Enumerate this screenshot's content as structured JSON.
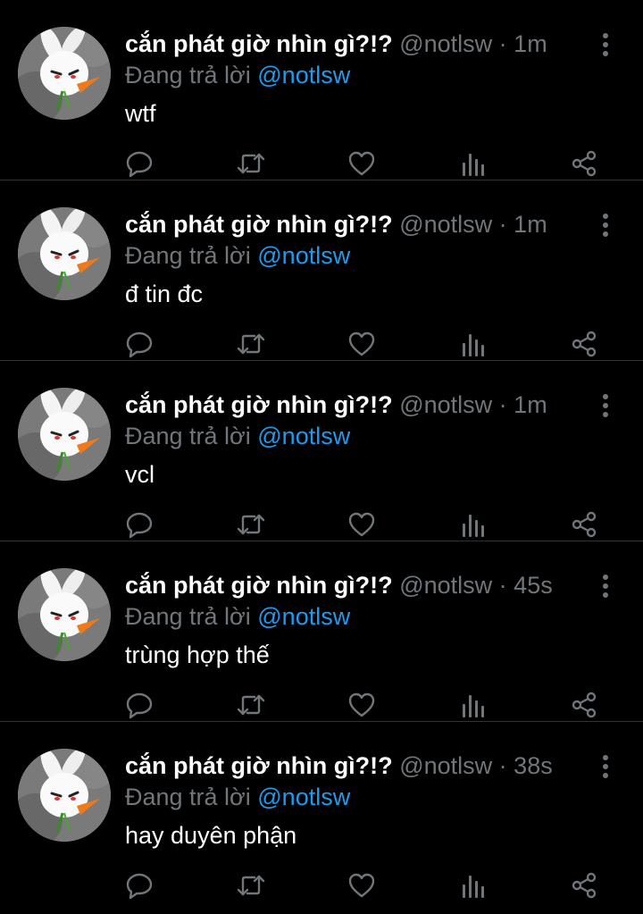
{
  "colors": {
    "background": "#000000",
    "name": "#ffffff",
    "muted": "#71767b",
    "link": "#1d9bf0",
    "divider": "#2f3336"
  },
  "icons": {
    "more": "vertical-ellipsis-icon",
    "reply": "speech-bubble-icon",
    "retweet": "retweet-arrows-icon",
    "like": "heart-icon",
    "stats": "bar-chart-icon",
    "share": "share-icon"
  },
  "tweets": [
    {
      "name": "cắn phát giờ nhìn gì?!?",
      "handle": "@notlsw",
      "separator": "·",
      "time": "1m",
      "reply_prefix": "Đang trả lời ",
      "reply_to": "@notlsw",
      "text": "wtf"
    },
    {
      "name": "cắn phát giờ nhìn gì?!?",
      "handle": "@notlsw",
      "separator": "·",
      "time": "1m",
      "reply_prefix": "Đang trả lời ",
      "reply_to": "@notlsw",
      "text": "đ tin đc"
    },
    {
      "name": "cắn phát giờ nhìn gì?!?",
      "handle": "@notlsw",
      "separator": "·",
      "time": "1m",
      "reply_prefix": "Đang trả lời ",
      "reply_to": "@notlsw",
      "text": "vcl"
    },
    {
      "name": "cắn phát giờ nhìn gì?!?",
      "handle": "@notlsw",
      "separator": "·",
      "time": "45s",
      "reply_prefix": "Đang trả lời ",
      "reply_to": "@notlsw",
      "text": "trùng hợp thế"
    },
    {
      "name": "cắn phát giờ nhìn gì?!?",
      "handle": "@notlsw",
      "separator": "·",
      "time": "38s",
      "reply_prefix": "Đang trả lời ",
      "reply_to": "@notlsw",
      "text": "hay duyên phận"
    }
  ]
}
